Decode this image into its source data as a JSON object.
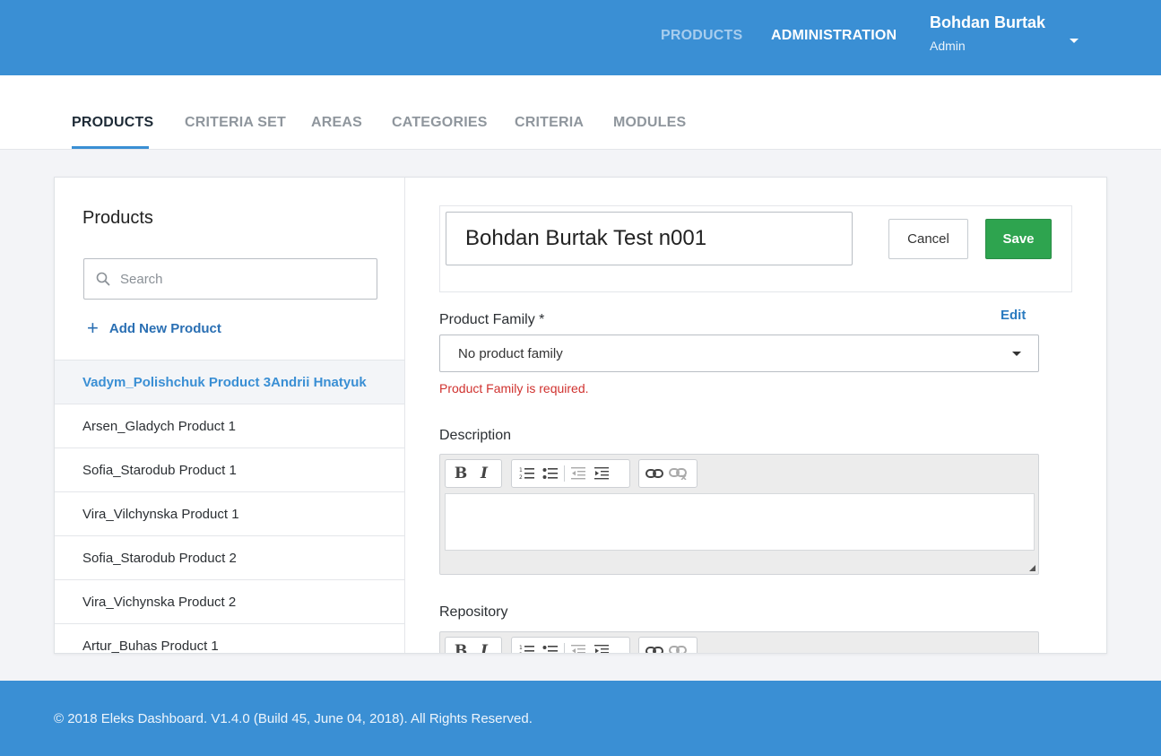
{
  "colors": {
    "brand_blue": "#3a8fd4",
    "save_green": "#2ea44f",
    "error_red": "#d0322f",
    "link_blue": "#2a7bc0"
  },
  "topbar": {
    "nav": [
      {
        "label": "PRODUCTS"
      },
      {
        "label": "ADMINISTRATION"
      }
    ],
    "user": {
      "name": "Bohdan Burtak",
      "role": "Admin",
      "menu_icon": "caret-down-icon"
    }
  },
  "subnav": {
    "tabs": [
      {
        "label": "PRODUCTS",
        "active": true
      },
      {
        "label": "CRITERIA SET"
      },
      {
        "label": "AREAS"
      },
      {
        "label": "CATEGORIES"
      },
      {
        "label": "CRITERIA"
      },
      {
        "label": "MODULES"
      }
    ]
  },
  "products_panel": {
    "title": "Products",
    "search_placeholder": "Search",
    "search_value": "",
    "add_label": "Add New Product",
    "items": [
      {
        "label": "Vadym_Polishchuk Product 3Andrii Hnatyuk",
        "selected": true
      },
      {
        "label": "Arsen_Gladych Product 1"
      },
      {
        "label": "Sofia_Starodub Product 1"
      },
      {
        "label": "Vira_Vilchynska Product 1"
      },
      {
        "label": "Sofia_Starodub Product 2"
      },
      {
        "label": "Vira_Vichynska Product 2"
      },
      {
        "label": "Artur_Buhas Product 1"
      }
    ]
  },
  "editor": {
    "title_value": "Bohdan Burtak Test n001",
    "cancel_label": "Cancel",
    "save_label": "Save",
    "product_family": {
      "label": "Product Family *",
      "edit_label": "Edit",
      "selected": "No product family",
      "error": "Product Family is required."
    },
    "description": {
      "label": "Description",
      "value": ""
    },
    "repository": {
      "label": "Repository"
    },
    "toolbar": {
      "bold": "B",
      "italic": "I"
    }
  },
  "footer": {
    "text": "© 2018 Eleks Dashboard. V1.4.0 (Build 45, June 04, 2018). All Rights Reserved."
  }
}
